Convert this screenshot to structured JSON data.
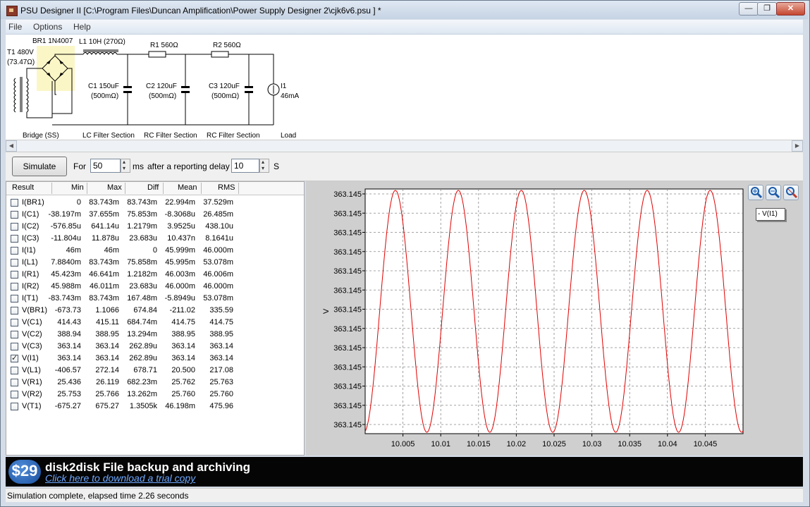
{
  "window": {
    "title": "PSU Designer II  [C:\\Program Files\\Duncan Amplification\\Power Supply Designer 2\\cjk6v6.psu ] *",
    "minimize_glyph": "—",
    "restore_glyph": "❐",
    "close_glyph": "✕"
  },
  "menu": [
    "File",
    "Options",
    "Help"
  ],
  "schematic": {
    "transformer": [
      "T1 480V",
      "(73.47Ω)"
    ],
    "bridge": "BR1 1N4007",
    "inductor": "L1 10H (270Ω)",
    "r1": "R1 560Ω",
    "r2": "R2 560Ω",
    "c1": [
      "C1 150uF",
      "(500mΩ)"
    ],
    "c2": [
      "C2 120uF",
      "(500mΩ)"
    ],
    "c3": [
      "C3 120uF",
      "(500mΩ)"
    ],
    "load": [
      "I1",
      "46mA"
    ],
    "sections": [
      "Bridge (SS)",
      "LC Filter Section",
      "RC Filter Section",
      "RC Filter Section",
      "Load"
    ]
  },
  "toolbar": {
    "simulate_label": "Simulate",
    "for_label": "For",
    "for_value": "50",
    "ms_label": "ms",
    "after_label": "after a reporting delay of",
    "delay_value": "10",
    "s_label": "S"
  },
  "results": {
    "columns": [
      "Result",
      "Min",
      "Max",
      "Diff",
      "Mean",
      "RMS"
    ],
    "rows": [
      {
        "name": "I(BR1)",
        "checked": false,
        "min": "0",
        "max": "83.743m",
        "diff": "83.743m",
        "mean": "22.994m",
        "rms": "37.529m"
      },
      {
        "name": "I(C1)",
        "checked": false,
        "min": "-38.197m",
        "max": "37.655m",
        "diff": "75.853m",
        "mean": "-8.3068u",
        "rms": "26.485m"
      },
      {
        "name": "I(C2)",
        "checked": false,
        "min": "-576.85u",
        "max": "641.14u",
        "diff": "1.2179m",
        "mean": "3.9525u",
        "rms": "438.10u"
      },
      {
        "name": "I(C3)",
        "checked": false,
        "min": "-11.804u",
        "max": "11.878u",
        "diff": "23.683u",
        "mean": "10.437n",
        "rms": "8.1641u"
      },
      {
        "name": "I(I1)",
        "checked": false,
        "min": "46m",
        "max": "46m",
        "diff": "0",
        "mean": "45.999m",
        "rms": "46.000m"
      },
      {
        "name": "I(L1)",
        "checked": false,
        "min": "7.8840m",
        "max": "83.743m",
        "diff": "75.858m",
        "mean": "45.995m",
        "rms": "53.078m"
      },
      {
        "name": "I(R1)",
        "checked": false,
        "min": "45.423m",
        "max": "46.641m",
        "diff": "1.2182m",
        "mean": "46.003m",
        "rms": "46.006m"
      },
      {
        "name": "I(R2)",
        "checked": false,
        "min": "45.988m",
        "max": "46.011m",
        "diff": "23.683u",
        "mean": "46.000m",
        "rms": "46.000m"
      },
      {
        "name": "I(T1)",
        "checked": false,
        "min": "-83.743m",
        "max": "83.743m",
        "diff": "167.48m",
        "mean": "-5.8949u",
        "rms": "53.078m"
      },
      {
        "name": "V(BR1)",
        "checked": false,
        "min": "-673.73",
        "max": "1.1066",
        "diff": "674.84",
        "mean": "-211.02",
        "rms": "335.59"
      },
      {
        "name": "V(C1)",
        "checked": false,
        "min": "414.43",
        "max": "415.11",
        "diff": "684.74m",
        "mean": "414.75",
        "rms": "414.75"
      },
      {
        "name": "V(C2)",
        "checked": false,
        "min": "388.94",
        "max": "388.95",
        "diff": "13.294m",
        "mean": "388.95",
        "rms": "388.95"
      },
      {
        "name": "V(C3)",
        "checked": false,
        "min": "363.14",
        "max": "363.14",
        "diff": "262.89u",
        "mean": "363.14",
        "rms": "363.14"
      },
      {
        "name": "V(I1)",
        "checked": true,
        "min": "363.14",
        "max": "363.14",
        "diff": "262.89u",
        "mean": "363.14",
        "rms": "363.14"
      },
      {
        "name": "V(L1)",
        "checked": false,
        "min": "-406.57",
        "max": "272.14",
        "diff": "678.71",
        "mean": "20.500",
        "rms": "217.08"
      },
      {
        "name": "V(R1)",
        "checked": false,
        "min": "25.436",
        "max": "26.119",
        "diff": "682.23m",
        "mean": "25.762",
        "rms": "25.763"
      },
      {
        "name": "V(R2)",
        "checked": false,
        "min": "25.753",
        "max": "25.766",
        "diff": "13.262m",
        "mean": "25.760",
        "rms": "25.760"
      },
      {
        "name": "V(T1)",
        "checked": false,
        "min": "-675.27",
        "max": "675.27",
        "diff": "1.3505k",
        "mean": "46.198m",
        "rms": "475.96"
      }
    ]
  },
  "graph": {
    "legend": "- V(I1)",
    "zoom_icons": [
      "zoom-in-icon",
      "zoom-out-icon",
      "zoom-reset-icon"
    ]
  },
  "chart_data": {
    "type": "line",
    "title": "",
    "xlabel": "",
    "ylabel": "V",
    "x_ticks": [
      "10.005",
      "10.01",
      "10.015",
      "10.02",
      "10.025",
      "10.03",
      "10.035",
      "10.04",
      "10.045"
    ],
    "y_ticks": [
      "363.145",
      "363.145",
      "363.145",
      "363.145",
      "363.145",
      "363.145",
      "363.145",
      "363.145",
      "363.145",
      "363.145",
      "363.145",
      "363.145",
      "363.145"
    ],
    "xlim": [
      10.0,
      10.05
    ],
    "grid": true,
    "series": [
      {
        "name": "V(I1)",
        "color": "#e00000",
        "shape": "sinusoid",
        "period": 0.00833,
        "first_peak_x": 10.004,
        "min": 363.14,
        "max": 363.14
      }
    ]
  },
  "ad": {
    "price_text": "$29",
    "title": "disk2disk File backup and archiving",
    "link": "Click here to download a trial copy"
  },
  "status": "Simulation complete, elapsed time 2.26 seconds"
}
